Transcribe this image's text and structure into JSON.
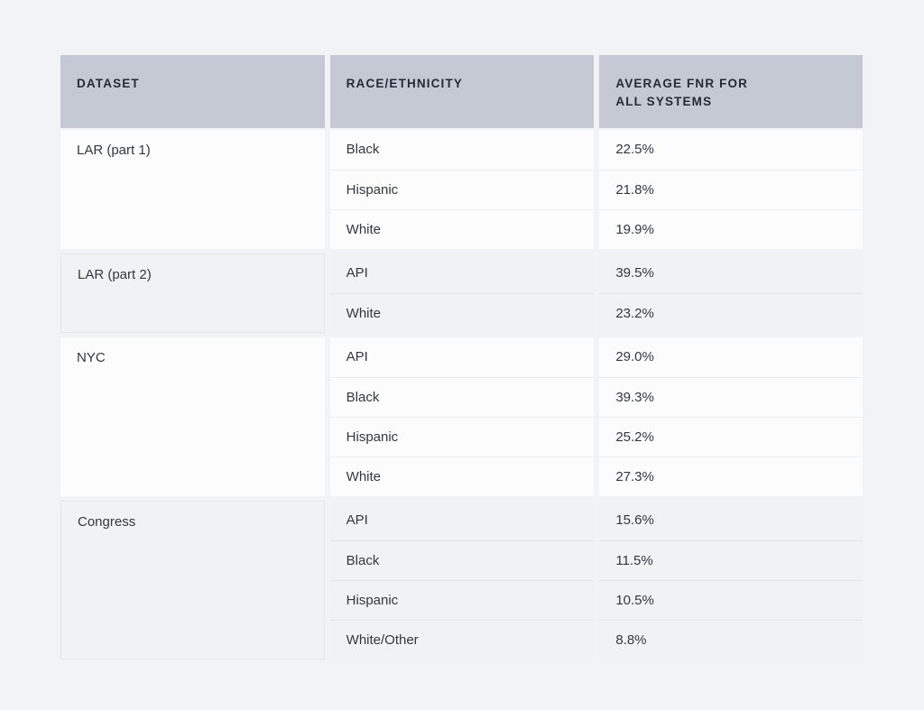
{
  "table": {
    "headers": {
      "dataset": "DATASET",
      "race": "RACE/ETHNICITY",
      "fnr_line1": "AVERAGE FNR FOR",
      "fnr_line2": "ALL SYSTEMS"
    },
    "colors": {
      "page_background": "#f2f3f5",
      "header_background": "#c5c9d4",
      "header_text": "#252a36",
      "row_light": "#fcfcfd",
      "row_gray": "#f1f2f4",
      "border": "#e4e6ea",
      "body_text": "#33373f"
    },
    "groups": [
      {
        "dataset": "LAR (part 1)",
        "tint": "light",
        "rows": [
          {
            "race": "Black",
            "fnr": "22.5%"
          },
          {
            "race": "Hispanic",
            "fnr": "21.8%"
          },
          {
            "race": "White",
            "fnr": "19.9%"
          }
        ]
      },
      {
        "dataset": "LAR (part 2)",
        "tint": "gray",
        "rows": [
          {
            "race": "API",
            "fnr": "39.5%"
          },
          {
            "race": "White",
            "fnr": "23.2%"
          }
        ]
      },
      {
        "dataset": "NYC",
        "tint": "light",
        "rows": [
          {
            "race": "API",
            "fnr": "29.0%"
          },
          {
            "race": "Black",
            "fnr": "39.3%"
          },
          {
            "race": "Hispanic",
            "fnr": "25.2%"
          },
          {
            "race": "White",
            "fnr": "27.3%"
          }
        ]
      },
      {
        "dataset": "Congress",
        "tint": "gray",
        "rows": [
          {
            "race": "API",
            "fnr": "15.6%"
          },
          {
            "race": "Black",
            "fnr": "11.5%"
          },
          {
            "race": "Hispanic",
            "fnr": "10.5%"
          },
          {
            "race": "White/Other",
            "fnr": "8.8%"
          }
        ]
      }
    ]
  }
}
